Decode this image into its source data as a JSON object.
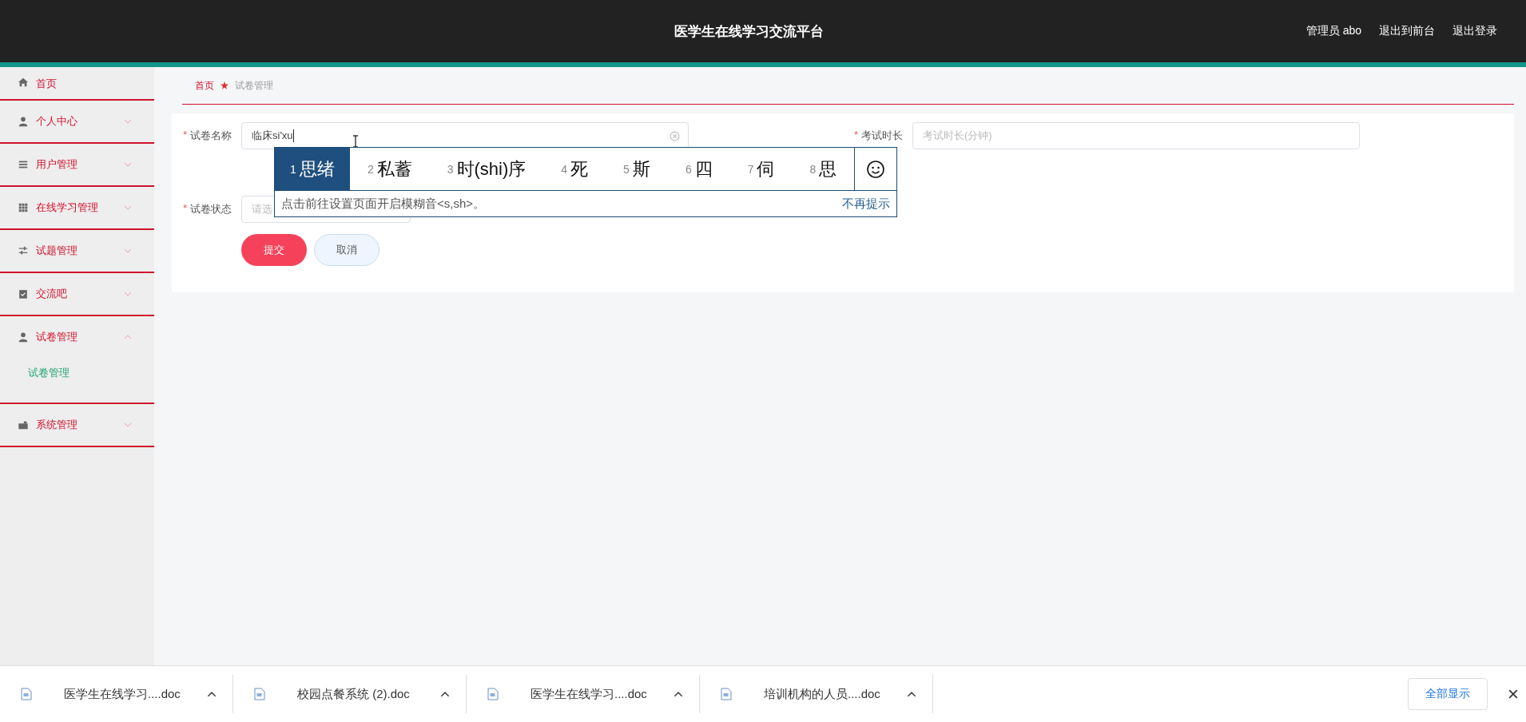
{
  "header": {
    "title": "医学生在线学习交流平台",
    "links": [
      "管理员 abo",
      "退出到前台",
      "退出登录"
    ]
  },
  "sidebar": {
    "items": [
      {
        "label": "首页",
        "kind": "link"
      },
      {
        "label": "个人中心",
        "kind": "menu",
        "expanded": false
      },
      {
        "label": "用户管理",
        "kind": "menu",
        "expanded": false
      },
      {
        "label": "在线学习管理",
        "kind": "menu",
        "expanded": false
      },
      {
        "label": "试题管理",
        "kind": "menu",
        "expanded": false
      },
      {
        "label": "交流吧",
        "kind": "menu",
        "expanded": false
      },
      {
        "label": "试卷管理",
        "kind": "menu",
        "expanded": true,
        "children": [
          {
            "label": "试卷管理",
            "selected": true
          }
        ]
      },
      {
        "label": "系统管理",
        "kind": "menu",
        "expanded": false
      }
    ]
  },
  "breadcrumb": [
    "首页",
    "试卷管理"
  ],
  "form": {
    "rows": [
      [
        {
          "label": "试卷名称",
          "required_mark": "*",
          "kind": "text",
          "value": "临床si'xu",
          "clearable": true
        },
        {
          "label": "考试时长",
          "required_mark": "*",
          "kind": "text",
          "placeholder": "考试时长(分钟)"
        }
      ],
      [
        {
          "label": "试卷状态",
          "required_mark": "*",
          "kind": "select",
          "placeholder": "请选"
        }
      ]
    ],
    "buttons": [
      {
        "label": "提交",
        "kind": "primary"
      },
      {
        "label": "取消",
        "kind": "secondary"
      }
    ]
  },
  "ime": {
    "candidates": [
      {
        "number": "1",
        "text": "思绪",
        "selected": true
      },
      {
        "number": "2",
        "text": "私蓄",
        "selected": false
      },
      {
        "number": "3",
        "text": "时(shi)序",
        "selected": false
      },
      {
        "number": "4",
        "text": "死",
        "selected": false
      },
      {
        "number": "5",
        "text": "斯",
        "selected": false
      },
      {
        "number": "6",
        "text": "四",
        "selected": false
      },
      {
        "number": "7",
        "text": "伺",
        "selected": false
      },
      {
        "number": "8",
        "text": "思",
        "selected": false
      }
    ],
    "hint": "点击前往设置页面开启模糊音<s,sh>。",
    "dismiss": "不再提示"
  },
  "downloads": {
    "files": [
      "医学生在线学习....doc",
      "校园点餐系统 (2).doc",
      "医学生在线学习....doc",
      "培训机构的人员....doc"
    ],
    "show_all": "全部显示"
  }
}
